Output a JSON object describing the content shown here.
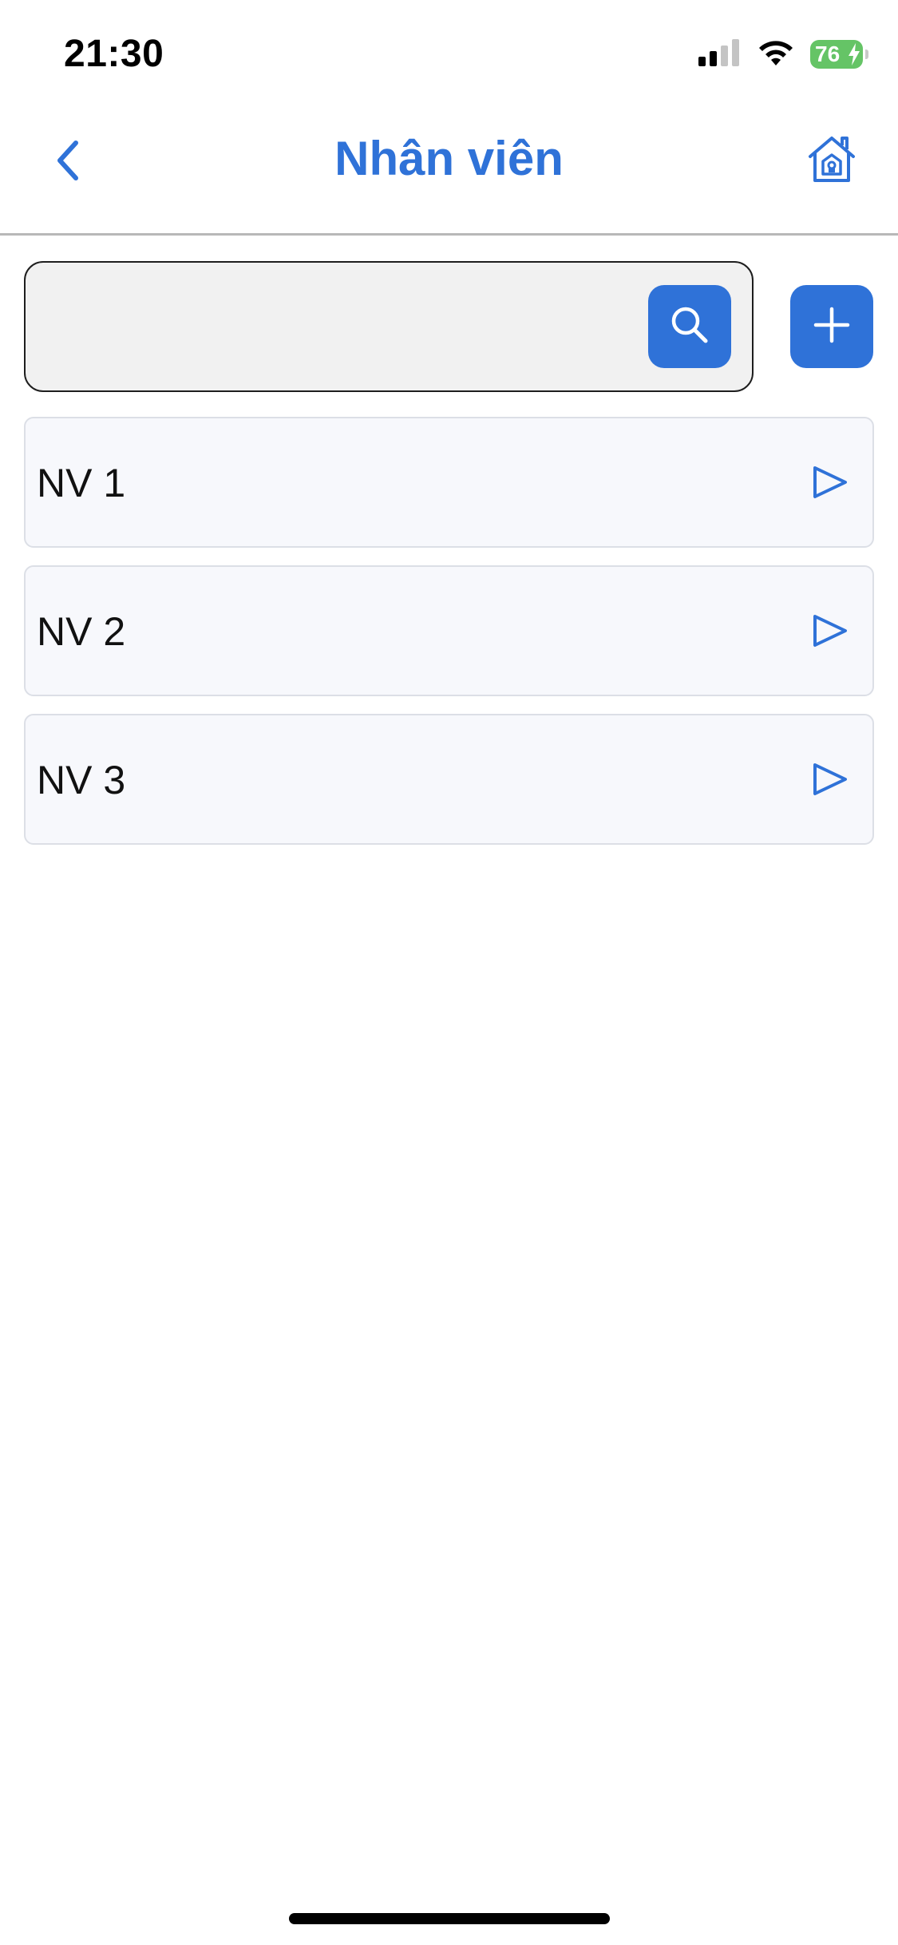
{
  "status_bar": {
    "time": "21:30",
    "battery": "76"
  },
  "header": {
    "title": "Nhân viên",
    "back_icon": "chevron-left-icon",
    "home_icon": "home-icon"
  },
  "search": {
    "value": "",
    "placeholder": "",
    "search_icon": "search-icon",
    "add_icon": "plus-icon"
  },
  "employees": [
    {
      "label": "NV 1",
      "icon": "play-arrow-icon"
    },
    {
      "label": "NV 2",
      "icon": "play-arrow-icon"
    },
    {
      "label": "NV 3",
      "icon": "play-arrow-icon"
    }
  ],
  "colors": {
    "accent": "#2f72d8",
    "battery": "#65c466",
    "item_background": "#f7f8fc",
    "search_background": "#f1f1f1"
  }
}
